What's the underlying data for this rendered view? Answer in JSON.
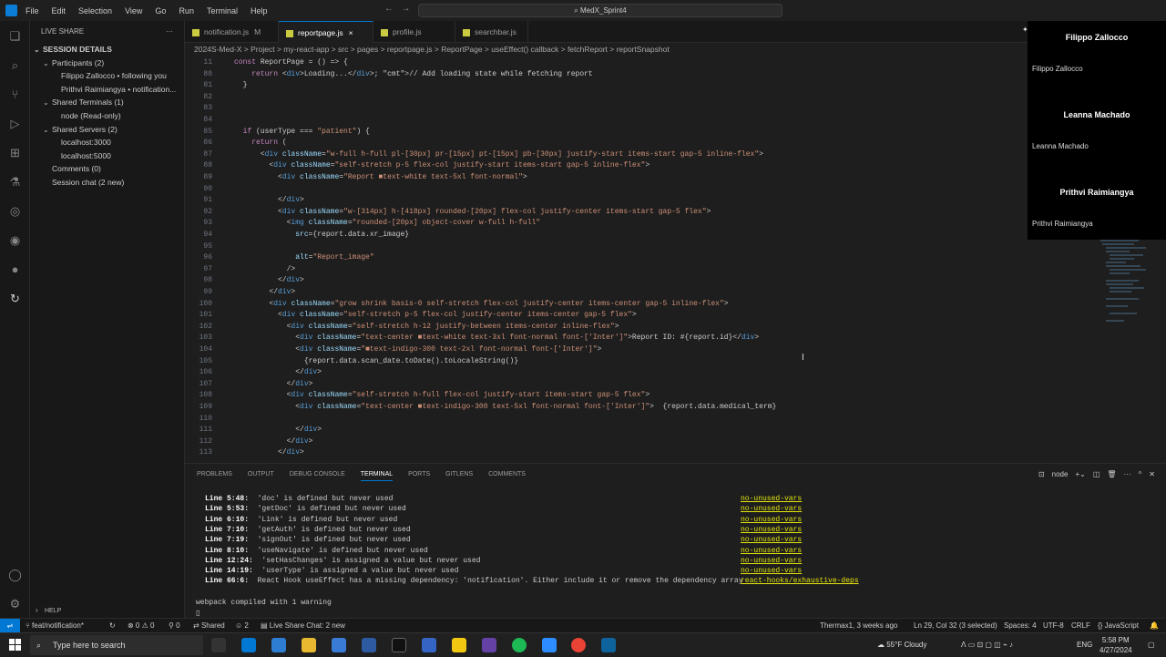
{
  "menu": [
    "File",
    "Edit",
    "Selection",
    "View",
    "Go",
    "Run",
    "Terminal",
    "Help"
  ],
  "command_center": "MedX_Sprint4",
  "sidebar": {
    "title": "LIVE SHARE",
    "items": [
      {
        "chev": "v",
        "label": "SESSION DETAILS",
        "indent": 0,
        "bold": true
      },
      {
        "chev": "v",
        "label": "Participants (2)",
        "indent": 1
      },
      {
        "chev": "",
        "label": "Filippo Zallocco  • following you",
        "indent": 2
      },
      {
        "chev": "",
        "label": "Prithvi Raimiangya  • notification...",
        "indent": 2
      },
      {
        "chev": "v",
        "label": "Shared Terminals (1)",
        "indent": 1
      },
      {
        "chev": "",
        "label": "node (Read-only)",
        "indent": 2
      },
      {
        "chev": "v",
        "label": "Shared Servers (2)",
        "indent": 1
      },
      {
        "chev": "",
        "label": "localhost:3000",
        "indent": 2
      },
      {
        "chev": "",
        "label": "localhost:5000",
        "indent": 2
      },
      {
        "chev": "",
        "label": "Comments (0)",
        "indent": 1
      },
      {
        "chev": "",
        "label": "Session chat (2 new)",
        "indent": 1
      }
    ],
    "help": "HELP"
  },
  "tabs": [
    {
      "label": "notification.js",
      "mod": "M",
      "active": false
    },
    {
      "label": "reportpage.js",
      "mod": "×",
      "active": true
    },
    {
      "label": "profile.js",
      "mod": "",
      "active": false
    },
    {
      "label": "searchbar.js",
      "mod": "",
      "active": false
    }
  ],
  "breadcrumb": "2024S-Med-X  >  Project  >  my-react-app  >  src  >  pages  >  reportpage.js  >  ReportPage  >  useEffect() callback  >  fetchReport  >  reportSnapshot",
  "code": [
    {
      "n": "11",
      "t": "const ReportPage = () => {"
    },
    {
      "n": "80",
      "t": "    return <div>Loading...</div>; // Add loading state while fetching report"
    },
    {
      "n": "81",
      "t": "  }"
    },
    {
      "n": "82",
      "t": ""
    },
    {
      "n": "83",
      "t": ""
    },
    {
      "n": "84",
      "t": ""
    },
    {
      "n": "85",
      "t": "  if (userType === \"patient\") {"
    },
    {
      "n": "86",
      "t": "    return ("
    },
    {
      "n": "87",
      "t": "      <div className=\"w-full h-full pl-[30px] pr-[15px] pt-[15px] pb-[30px] justify-start items-start gap-5 inline-flex\">"
    },
    {
      "n": "88",
      "t": "        <div className=\"self-stretch p-5 flex-col justify-start items-start gap-5 inline-flex\">"
    },
    {
      "n": "89",
      "t": "          <div className=\"Report ■text-white text-5xl font-normal\">"
    },
    {
      "n": "90",
      "t": ""
    },
    {
      "n": "91",
      "t": "          </div>"
    },
    {
      "n": "92",
      "t": "          <div className=\"w-[314px] h-[418px] rounded-[20px] flex-col justify-center items-start gap-5 flex\">"
    },
    {
      "n": "93",
      "t": "            <img className=\"rounded-[20px] object-cover w-full h-full\""
    },
    {
      "n": "94",
      "t": "              src={report.data.xr_image}"
    },
    {
      "n": "95",
      "t": ""
    },
    {
      "n": "96",
      "t": "              alt=\"Report_image\""
    },
    {
      "n": "97",
      "t": "            />"
    },
    {
      "n": "98",
      "t": "          </div>"
    },
    {
      "n": "99",
      "t": "        </div>"
    },
    {
      "n": "100",
      "t": "        <div className=\"grow shrink basis-0 self-stretch flex-col justify-center items-center gap-5 inline-flex\">"
    },
    {
      "n": "101",
      "t": "          <div className=\"self-stretch p-5 flex-col justify-center items-center gap-5 flex\">"
    },
    {
      "n": "102",
      "t": "            <div className=\"self-stretch h-12 justify-between items-center inline-flex\">"
    },
    {
      "n": "103",
      "t": "              <div className=\"text-center ■text-white text-3xl font-normal font-['Inter']\">Report ID: #{report.id}</div>"
    },
    {
      "n": "104",
      "t": "              <div className=\"■text-indigo-300 text-2xl font-normal font-['Inter']\">"
    },
    {
      "n": "105",
      "t": "                {report.data.scan_date.toDate().toLocaleString()}"
    },
    {
      "n": "106",
      "t": "              </div>"
    },
    {
      "n": "107",
      "t": "            </div>"
    },
    {
      "n": "108",
      "t": "            <div className=\"self-stretch h-full flex-col justify-start items-start gap-5 flex\">"
    },
    {
      "n": "109",
      "t": "              <div className=\"text-center ■text-indigo-300 text-5xl font-normal font-['Inter']\">  {report.data.medical_term}"
    },
    {
      "n": "110",
      "t": ""
    },
    {
      "n": "111",
      "t": "              </div>"
    },
    {
      "n": "112",
      "t": "            </div>"
    },
    {
      "n": "113",
      "t": "          </div>"
    }
  ],
  "participants": [
    {
      "name": "Filippo Zallocco",
      "sub": "Filippo Zallocco"
    },
    {
      "name": "Leanna Machado",
      "sub": "Leanna Machado"
    },
    {
      "name": "Prithvi Raimiangya",
      "sub": "Prithvi Raimiangya"
    }
  ],
  "panel": {
    "tabs": [
      "PROBLEMS",
      "OUTPUT",
      "DEBUG CONSOLE",
      "TERMINAL",
      "PORTS",
      "GITLENS",
      "COMMENTS"
    ],
    "active": "TERMINAL",
    "shell": "node",
    "lines": [
      {
        "loc": "Line 5:48:",
        "msg": "'doc' is defined but never used",
        "rule": "no-unused-vars"
      },
      {
        "loc": "Line 5:53:",
        "msg": "'getDoc' is defined but never used",
        "rule": "no-unused-vars"
      },
      {
        "loc": "Line 6:10:",
        "msg": "'Link' is defined but never used",
        "rule": "no-unused-vars"
      },
      {
        "loc": "Line 7:10:",
        "msg": "'getAuth' is defined but never used",
        "rule": "no-unused-vars"
      },
      {
        "loc": "Line 7:19:",
        "msg": "'signOut' is defined but never used",
        "rule": "no-unused-vars"
      },
      {
        "loc": "Line 8:10:",
        "msg": "'useNavigate' is defined but never used",
        "rule": "no-unused-vars"
      },
      {
        "loc": "Line 12:24:",
        "msg": "'setHasChanges' is assigned a value but never used",
        "rule": "no-unused-vars"
      },
      {
        "loc": "Line 14:19:",
        "msg": "'userType' is assigned a value but never used",
        "rule": "no-unused-vars"
      },
      {
        "loc": "Line 66:6:",
        "msg": "React Hook useEffect has a missing dependency: 'notification'. Either include it or remove the dependency array",
        "rule": "react-hooks/exhaustive-deps"
      }
    ],
    "compiled": "webpack compiled with 1 warning"
  },
  "status": {
    "branch": "feat/notification*",
    "errors": "⊗ 0 ⚠ 0",
    "ports": "0",
    "shared": "Shared",
    "count": "2",
    "liveshare": "Live Share Chat: 2 new",
    "blame": "Thermax1, 3 weeks ago",
    "position": "Ln 29, Col 32 (3 selected)",
    "spaces": "Spaces: 4",
    "encoding": "UTF-8",
    "eol": "CRLF",
    "lang": "JavaScript"
  },
  "taskbar": {
    "search": "Type here to search",
    "weather": "55°F  Cloudy",
    "lang": "ENG",
    "time": "5:58 PM",
    "date": "4/27/2024"
  }
}
